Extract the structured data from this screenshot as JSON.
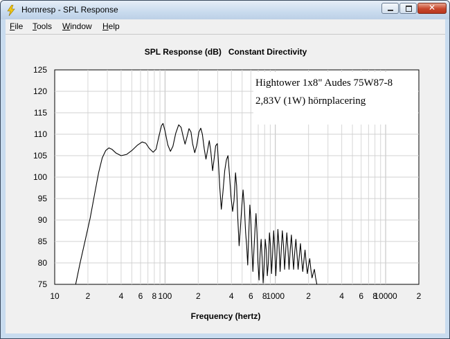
{
  "window": {
    "title": "Hornresp - SPL Response",
    "close_glyph": "✕"
  },
  "menu": [
    "File",
    "Tools",
    "Window",
    "Help"
  ],
  "chart_data": {
    "type": "line",
    "title": "SPL Response (dB)   Constant Directivity",
    "xlabel": "Frequency (hertz)",
    "ylabel": "",
    "x_scale": "log",
    "xlim": [
      10,
      20000
    ],
    "ylim": [
      75,
      125
    ],
    "grid": true,
    "y_ticks": [
      75,
      80,
      85,
      90,
      95,
      100,
      105,
      110,
      115,
      120,
      125
    ],
    "x_tick_labels": [
      {
        "value": 10,
        "label": "10"
      },
      {
        "value": 20,
        "label": "2"
      },
      {
        "value": 40,
        "label": "4"
      },
      {
        "value": 60,
        "label": "6"
      },
      {
        "value": 80,
        "label": "8"
      },
      {
        "value": 100,
        "label": "100"
      },
      {
        "value": 200,
        "label": "2"
      },
      {
        "value": 400,
        "label": "4"
      },
      {
        "value": 600,
        "label": "6"
      },
      {
        "value": 800,
        "label": "8"
      },
      {
        "value": 1000,
        "label": "1000"
      },
      {
        "value": 2000,
        "label": "2"
      },
      {
        "value": 4000,
        "label": "4"
      },
      {
        "value": 6000,
        "label": "6"
      },
      {
        "value": 8000,
        "label": "8"
      },
      {
        "value": 10000,
        "label": "10000"
      },
      {
        "value": 20000,
        "label": "2"
      }
    ],
    "annotations": [
      "Hightower 1x8\" Audes 75W87-8",
      "2,83V (1W) hörnplacering"
    ],
    "series": [
      {
        "color": "#000000",
        "points": [
          [
            15.5,
            75
          ],
          [
            17,
            80
          ],
          [
            19,
            85.5
          ],
          [
            21,
            90.5
          ],
          [
            23,
            96
          ],
          [
            25,
            101
          ],
          [
            27,
            104.5
          ],
          [
            29,
            106.2
          ],
          [
            31,
            106.8
          ],
          [
            33,
            106.5
          ],
          [
            36,
            105.6
          ],
          [
            40,
            105
          ],
          [
            45,
            105.3
          ],
          [
            50,
            106.2
          ],
          [
            56,
            107.4
          ],
          [
            62,
            108.2
          ],
          [
            67,
            107.9
          ],
          [
            72,
            106.7
          ],
          [
            78,
            105.8
          ],
          [
            83,
            106.5
          ],
          [
            88,
            109.5
          ],
          [
            93,
            112
          ],
          [
            96,
            112.5
          ],
          [
            100,
            110.8
          ],
          [
            106,
            107.5
          ],
          [
            112,
            106
          ],
          [
            118,
            107.2
          ],
          [
            125,
            110.2
          ],
          [
            133,
            112.2
          ],
          [
            140,
            111.6
          ],
          [
            146,
            109.5
          ],
          [
            152,
            107.7
          ],
          [
            158,
            109.3
          ],
          [
            165,
            111.3
          ],
          [
            172,
            110.5
          ],
          [
            178,
            107.8
          ],
          [
            186,
            105.7
          ],
          [
            194,
            107.4
          ],
          [
            203,
            110.5
          ],
          [
            211,
            111.4
          ],
          [
            218,
            110
          ],
          [
            227,
            106.5
          ],
          [
            235,
            104.2
          ],
          [
            244,
            106.5
          ],
          [
            252,
            108.5
          ],
          [
            260,
            106
          ],
          [
            270,
            101.5
          ],
          [
            278,
            104
          ],
          [
            288,
            107.3
          ],
          [
            298,
            107.8
          ],
          [
            305,
            103.5
          ],
          [
            314,
            97.5
          ],
          [
            324,
            92.5
          ],
          [
            335,
            96.5
          ],
          [
            348,
            101.5
          ],
          [
            360,
            104
          ],
          [
            372,
            105
          ],
          [
            384,
            100.5
          ],
          [
            396,
            95.5
          ],
          [
            410,
            92
          ],
          [
            422,
            94.5
          ],
          [
            436,
            101
          ],
          [
            446,
            98
          ],
          [
            456,
            91
          ],
          [
            470,
            84
          ],
          [
            482,
            88
          ],
          [
            496,
            93
          ],
          [
            510,
            97
          ],
          [
            524,
            93
          ],
          [
            538,
            87
          ],
          [
            550,
            84
          ],
          [
            562,
            79.5
          ],
          [
            575,
            87
          ],
          [
            588,
            93.5
          ],
          [
            600,
            90
          ],
          [
            612,
            84
          ],
          [
            626,
            78
          ],
          [
            640,
            83
          ],
          [
            655,
            88
          ],
          [
            668,
            91.5
          ],
          [
            682,
            87
          ],
          [
            696,
            80
          ],
          [
            712,
            76
          ],
          [
            728,
            82
          ],
          [
            744,
            85.5
          ],
          [
            760,
            81
          ],
          [
            776,
            75.3
          ],
          [
            794,
            80
          ],
          [
            810,
            85.5
          ],
          [
            828,
            83
          ],
          [
            846,
            77
          ],
          [
            864,
            80
          ],
          [
            884,
            87
          ],
          [
            904,
            84
          ],
          [
            924,
            77.5
          ],
          [
            944,
            82
          ],
          [
            966,
            87.5
          ],
          [
            988,
            83
          ],
          [
            1010,
            77
          ],
          [
            1032,
            82
          ],
          [
            1055,
            87.8
          ],
          [
            1080,
            84
          ],
          [
            1105,
            78
          ],
          [
            1130,
            82.5
          ],
          [
            1158,
            87.5
          ],
          [
            1186,
            84
          ],
          [
            1214,
            78.5
          ],
          [
            1242,
            83
          ],
          [
            1272,
            87
          ],
          [
            1302,
            83
          ],
          [
            1332,
            78.5
          ],
          [
            1365,
            83
          ],
          [
            1398,
            86.5
          ],
          [
            1430,
            82.5
          ],
          [
            1465,
            78.5
          ],
          [
            1500,
            82.5
          ],
          [
            1536,
            85.5
          ],
          [
            1572,
            82
          ],
          [
            1610,
            78.5
          ],
          [
            1650,
            81.5
          ],
          [
            1690,
            84.5
          ],
          [
            1730,
            81
          ],
          [
            1772,
            78
          ],
          [
            1815,
            80.5
          ],
          [
            1860,
            83
          ],
          [
            1905,
            80
          ],
          [
            1950,
            77.5
          ],
          [
            2000,
            79.5
          ],
          [
            2050,
            81
          ],
          [
            2100,
            78.5
          ],
          [
            2150,
            76.5
          ],
          [
            2200,
            77.5
          ],
          [
            2260,
            78.5
          ],
          [
            2320,
            76.5
          ],
          [
            2380,
            75
          ]
        ]
      }
    ]
  }
}
